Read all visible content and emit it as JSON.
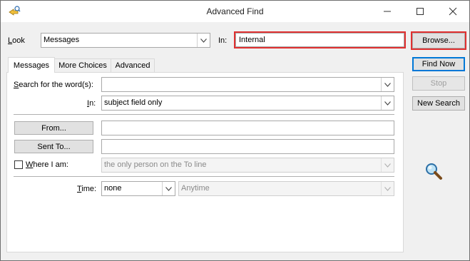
{
  "window": {
    "title": "Advanced Find",
    "minimize_icon": "minimize-icon",
    "maximize_icon": "maximize-icon",
    "close_icon": "close-icon"
  },
  "look": {
    "label_pre": "L",
    "label_rest": "ook",
    "selected": "Messages"
  },
  "in_field": {
    "label": "In:",
    "value": "Internal"
  },
  "buttons": {
    "browse": "Browse...",
    "find_now": "Find Now",
    "stop": "Stop",
    "new_search": "New Search"
  },
  "tabs": [
    {
      "label": "Messages"
    },
    {
      "label": "More Choices"
    },
    {
      "label": "Advanced"
    }
  ],
  "messages_tab": {
    "search_words": {
      "label_pre": "S",
      "label_rest": "earch for the word(s):",
      "value": ""
    },
    "in": {
      "label_pre": "I",
      "label_rest": "n:",
      "value": "subject field only"
    },
    "from": {
      "button": "From...",
      "value": ""
    },
    "sent_to": {
      "button": "Sent To...",
      "value": ""
    },
    "where_i_am": {
      "label_pre": "W",
      "label_rest": "here I am:",
      "value": "the only person on the To line",
      "checked": false
    },
    "time": {
      "label_pre": "T",
      "label_rest": "ime:",
      "value": "none",
      "range": "Anytime"
    }
  },
  "icons": {
    "app": "advanced-find-app-icon",
    "search": "magnifier-icon"
  },
  "colors": {
    "highlight": "#e03030",
    "accent": "#0078d7"
  }
}
